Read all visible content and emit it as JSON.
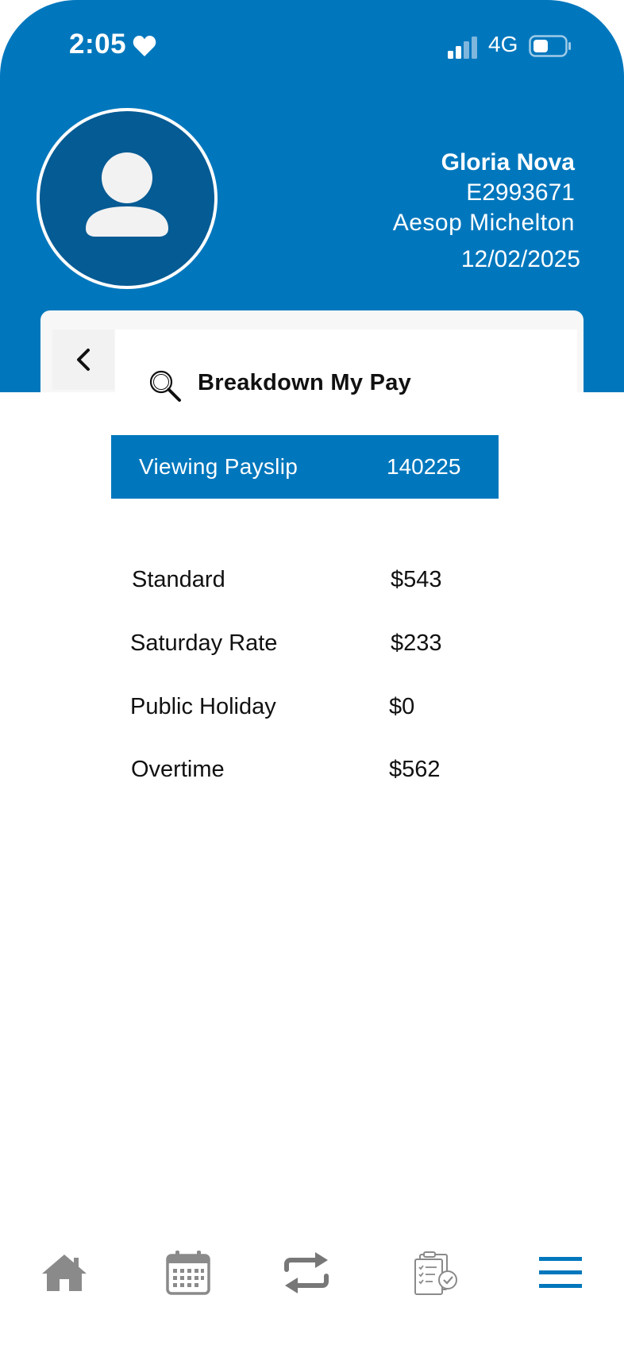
{
  "status_bar": {
    "time": "2:05",
    "network": "4G",
    "icons": [
      "heart-icon",
      "signal-icon",
      "battery-icon"
    ]
  },
  "profile": {
    "name": "Gloria Nova",
    "employee_id": "E2993671",
    "manager": "Aesop Michelton",
    "date": "12/02/2025"
  },
  "page": {
    "title": "Breakdown My Pay",
    "back_icon": "chevron-left-icon",
    "title_icon": "magnifier-icon"
  },
  "payslip": {
    "label": "Viewing Payslip",
    "number": "140225"
  },
  "pay_breakdown": [
    {
      "label": "Standard",
      "amount": "$543"
    },
    {
      "label": "Saturday Rate",
      "amount": "$233"
    },
    {
      "label": "Public Holiday",
      "amount": "$0"
    },
    {
      "label": "Overtime",
      "amount": "$562"
    }
  ],
  "bottom_nav": {
    "items": [
      "home-icon",
      "calendar-icon",
      "swap-icon",
      "timesheet-icon",
      "menu-icon"
    ]
  },
  "colors": {
    "brand_blue": "#0077bd",
    "avatar_bg": "#055b94",
    "icon_gray": "#8a8a8a"
  }
}
